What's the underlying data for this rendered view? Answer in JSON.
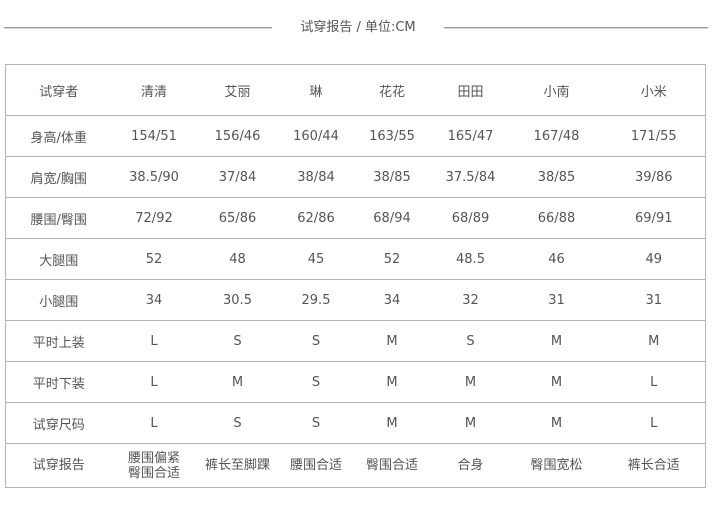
{
  "title": "试穿报告 / 单位:CM",
  "header": {
    "label": "试穿者",
    "names": [
      "清清",
      "艾丽",
      "琳",
      "花花",
      "田田",
      "小南",
      "小米"
    ]
  },
  "rows": [
    {
      "label": "身高/体重",
      "values": [
        "154/51",
        "156/46",
        "160/44",
        "163/55",
        "165/47",
        "167/48",
        "171/55"
      ]
    },
    {
      "label": "肩宽/胸围",
      "values": [
        "38.5/90",
        "37/84",
        "38/84",
        "38/85",
        "37.5/84",
        "38/85",
        "39/86"
      ]
    },
    {
      "label": "腰围/臀围",
      "values": [
        "72/92",
        "65/86",
        "62/86",
        "68/94",
        "68/89",
        "66/88",
        "69/91"
      ]
    },
    {
      "label": "大腿围",
      "values": [
        "52",
        "48",
        "45",
        "52",
        "48.5",
        "46",
        "49"
      ]
    },
    {
      "label": "小腿围",
      "values": [
        "34",
        "30.5",
        "29.5",
        "34",
        "32",
        "31",
        "31"
      ]
    },
    {
      "label": "平时上装",
      "values": [
        "L",
        "S",
        "S",
        "M",
        "S",
        "M",
        "M"
      ]
    },
    {
      "label": "平时下装",
      "values": [
        "L",
        "M",
        "S",
        "M",
        "M",
        "M",
        "L"
      ]
    },
    {
      "label": "试穿尺码",
      "values": [
        "L",
        "S",
        "S",
        "M",
        "M",
        "M",
        "L"
      ]
    }
  ],
  "report": {
    "label": "试穿报告",
    "first": [
      "腰围偏紧",
      "臀围合适"
    ],
    "values": [
      "裤长至脚踝",
      "腰围合适",
      "臀围合适",
      "合身",
      "臀围宽松",
      "裤长合适"
    ]
  }
}
